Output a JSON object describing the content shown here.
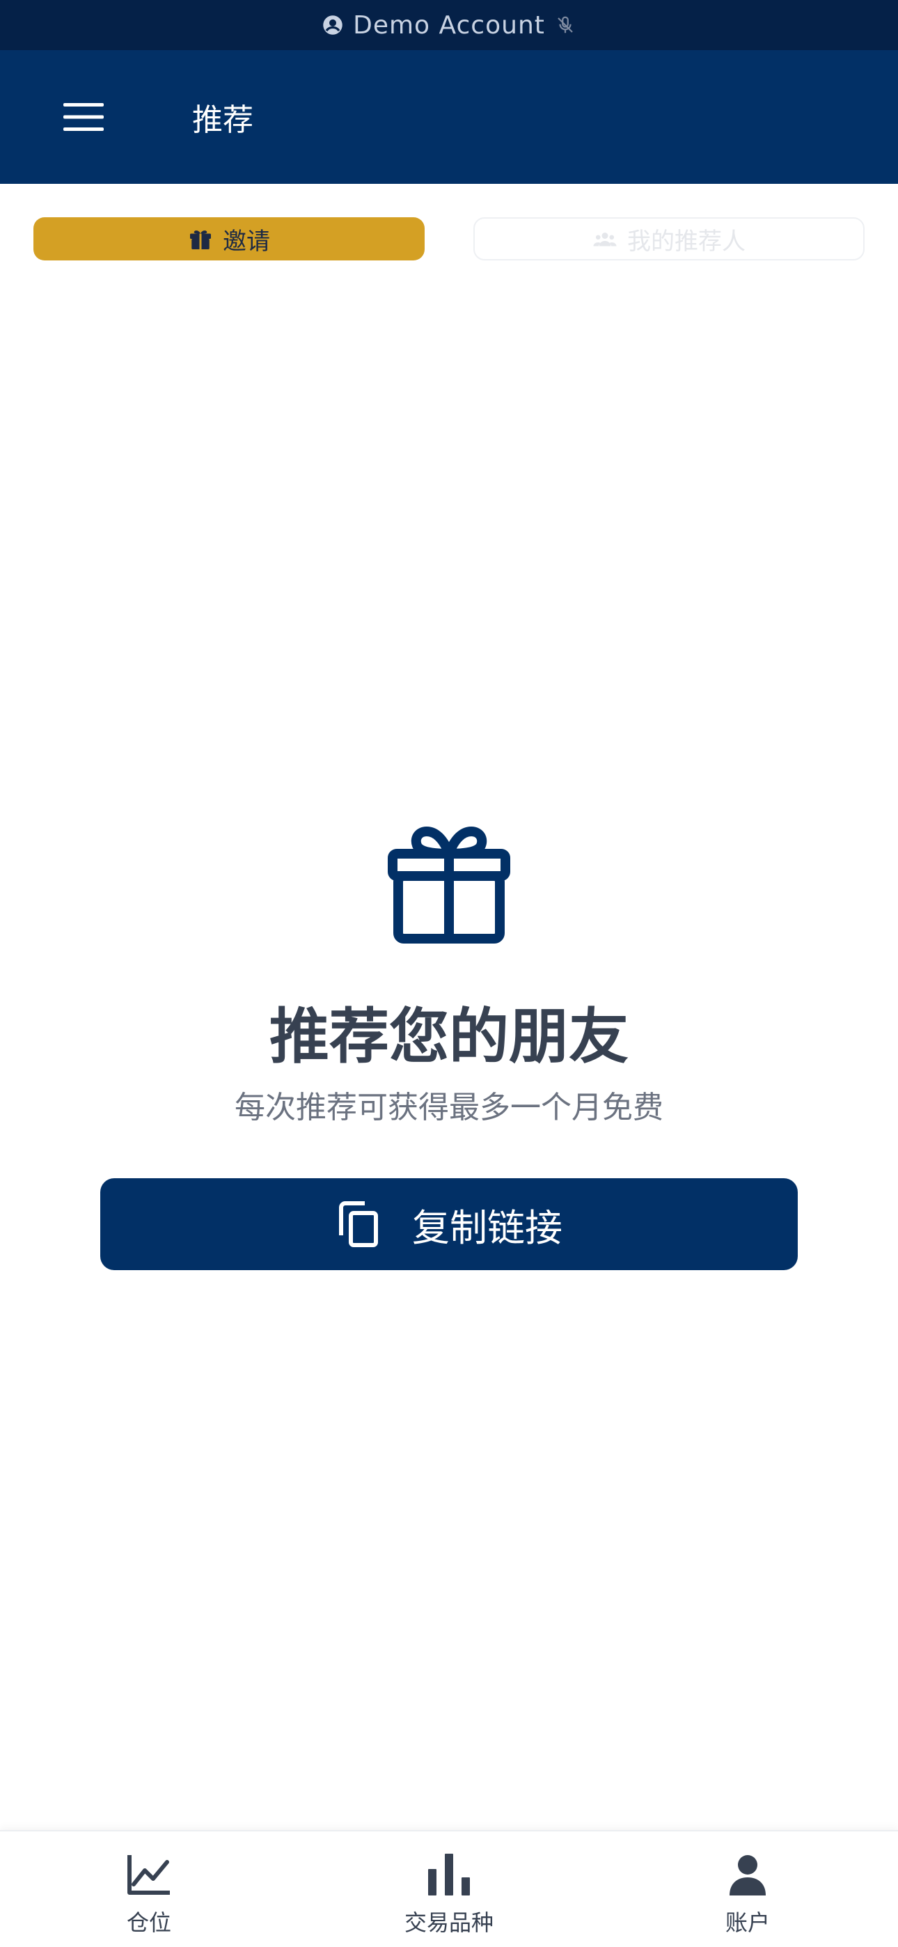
{
  "status_banner": {
    "text": "Demo Account",
    "icons": [
      "account-circle-icon",
      "microphone-off-icon"
    ]
  },
  "header": {
    "title": "推荐",
    "menu_icon": "hamburger-menu-icon"
  },
  "tabs": [
    {
      "label": "邀请",
      "icon": "gift-icon",
      "active": true,
      "color": "#d4a024"
    },
    {
      "label": "我的推荐人",
      "icon": "people-group-icon",
      "active": false
    }
  ],
  "main": {
    "hero_icon": "gift-icon",
    "headline": "推荐您的朋友",
    "subline": "每次推荐可获得最多一个月免费",
    "copy_button": {
      "label": "复制链接",
      "icon": "copy-icon"
    }
  },
  "bottom_nav": [
    {
      "label": "仓位",
      "icon": "line-chart-icon"
    },
    {
      "label": "交易品种",
      "icon": "bar-chart-icon"
    },
    {
      "label": "账户",
      "icon": "user-icon"
    }
  ],
  "colors": {
    "banner_bg": "#052148",
    "header_bg": "#023066",
    "accent_gold": "#d4a024",
    "primary_button": "#023066",
    "headline_text": "#374151",
    "subline_text": "#6b7280"
  }
}
